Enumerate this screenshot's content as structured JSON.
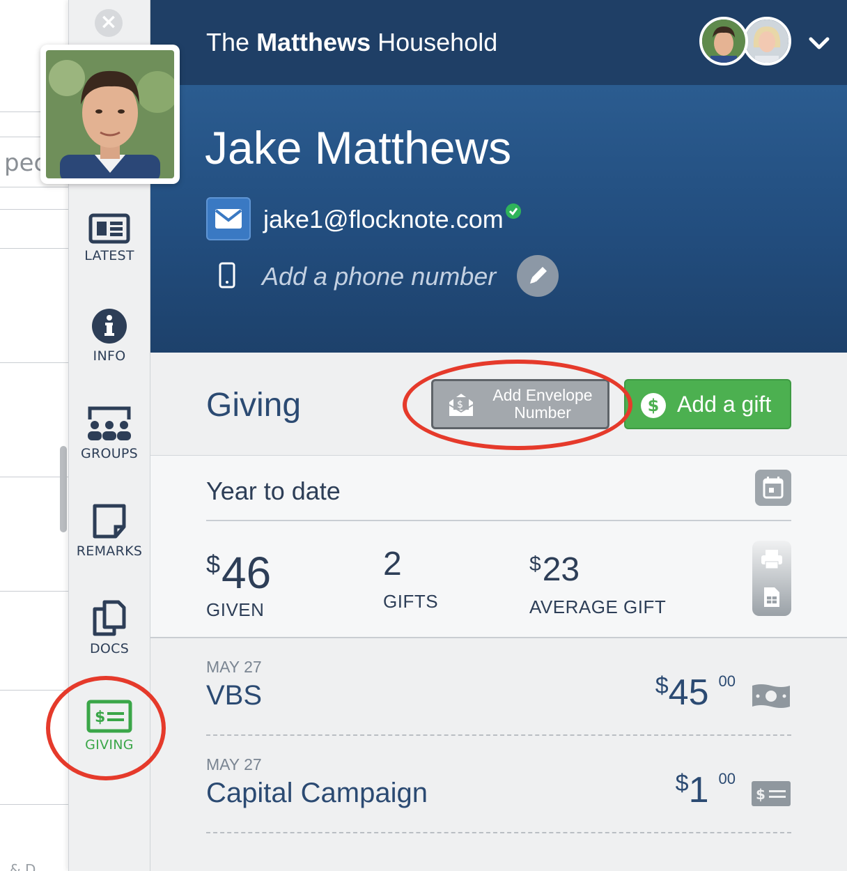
{
  "background": {
    "partial_text": "pec",
    "bottom_text": "& D"
  },
  "sidebar": {
    "items": [
      {
        "label": "LATEST",
        "icon": "newspaper-icon"
      },
      {
        "label": "INFO",
        "icon": "info-icon"
      },
      {
        "label": "GROUPS",
        "icon": "groups-icon"
      },
      {
        "label": "REMARKS",
        "icon": "note-icon"
      },
      {
        "label": "DOCS",
        "icon": "docs-icon"
      },
      {
        "label": "GIVING",
        "icon": "giving-icon",
        "active": true
      }
    ],
    "active_color": "#3aa648"
  },
  "header": {
    "household_prefix": "The",
    "household_name": "Matthews",
    "household_suffix": "Household"
  },
  "profile": {
    "name": "Jake Matthews",
    "email": "jake1@flocknote.com",
    "email_verified": true,
    "phone_placeholder": "Add a phone number"
  },
  "giving": {
    "title": "Giving",
    "envelope_button": "Add Envelope Number",
    "add_gift_button": "Add a gift",
    "ytd_title": "Year to date",
    "stats": [
      {
        "prefix": "$",
        "value": "46",
        "label": "GIVEN"
      },
      {
        "prefix": "",
        "value": "2",
        "label": "GIFTS"
      },
      {
        "prefix": "$",
        "value": "23",
        "label": "AVERAGE GIFT"
      }
    ],
    "gifts": [
      {
        "date": "MAY 27",
        "fund": "VBS",
        "dollar_sign": "$",
        "amount": "45",
        "cents": "00",
        "method_icon": "cash-icon"
      },
      {
        "date": "MAY 27",
        "fund": "Capital Campaign",
        "dollar_sign": "$",
        "amount": "1",
        "cents": "00",
        "method_icon": "check-icon"
      }
    ]
  },
  "colors": {
    "header": "#1f3f66",
    "hero": "#2b5c90",
    "accent_green": "#4cb050",
    "highlight_ring": "#e53a2b"
  }
}
